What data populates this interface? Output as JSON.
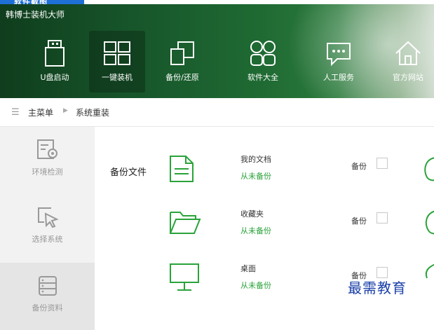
{
  "top_strip": {
    "text": "软件截图"
  },
  "header": {
    "title": "韩博士装机大师"
  },
  "nav": {
    "items": [
      {
        "label": "U盘启动",
        "icon": "usb-drive-icon"
      },
      {
        "label": "一键装机",
        "icon": "windows-icon",
        "active": true
      },
      {
        "label": "备份/还原",
        "icon": "backup-restore-icon"
      },
      {
        "label": "软件大全",
        "icon": "apps-grid-icon"
      },
      {
        "label": "人工服务",
        "icon": "chat-service-icon"
      },
      {
        "label": "官方网站",
        "icon": "home-icon"
      }
    ]
  },
  "breadcrumb": {
    "home": "主菜单",
    "current": "系统重装"
  },
  "sidebar": {
    "items": [
      {
        "label": "环境检测",
        "icon": "environment-check-icon"
      },
      {
        "label": "选择系统",
        "icon": "cursor-select-icon"
      },
      {
        "label": "备份资料",
        "icon": "storage-icon",
        "active": true
      }
    ]
  },
  "main": {
    "section_label": "备份文件",
    "rows": [
      {
        "name": "我的文档",
        "status": "从未备份",
        "backup_label": "备份",
        "icon": "document-icon"
      },
      {
        "name": "收藏夹",
        "status": "从未备份",
        "backup_label": "备份",
        "icon": "folder-icon"
      },
      {
        "name": "桌面",
        "status": "从未备份",
        "backup_label": "备份",
        "icon": "monitor-icon"
      }
    ]
  },
  "watermark": "最需教育",
  "colors": {
    "accent_green": "#2aa33a",
    "header_dark": "#17552a",
    "watermark_blue": "#1a3fa8"
  }
}
